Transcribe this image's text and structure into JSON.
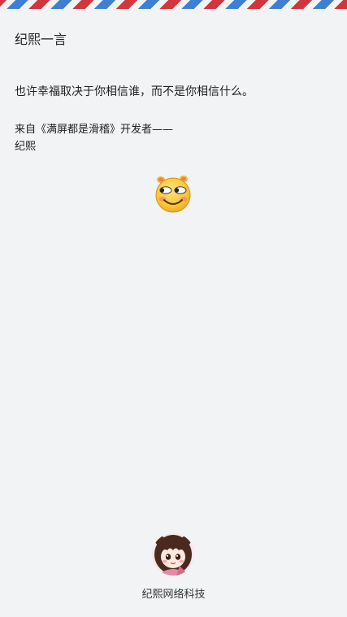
{
  "header": {
    "title": "纪熙一言"
  },
  "quote": {
    "text": "也许幸福取决于你相信谁，而不是你相信什么。",
    "source_line1": "来自《满屏都是滑稽》开发者——",
    "source_line2": "纪熙",
    "emoji": "smile-emoji"
  },
  "footer": {
    "company_name": "纪熙网络科技",
    "avatar": "avatar"
  },
  "colors": {
    "background": "#f2f3f5",
    "stripe_red": "#d2363c",
    "stripe_blue": "#3f7fd3",
    "text": "#222222"
  }
}
